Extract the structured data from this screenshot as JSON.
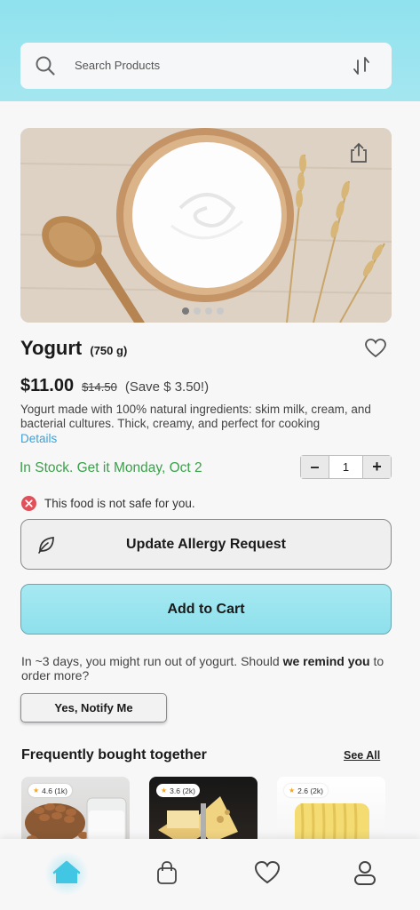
{
  "search": {
    "placeholder": "Search Products"
  },
  "product": {
    "name": "Yogurt",
    "weight": "(750 g)",
    "price": "$11.00",
    "old_price": "$14.50",
    "save": "(Save $ 3.50!)",
    "description": "Yogurt made with 100% natural ingredients: skim milk, cream, and bacterial cultures. Thick, creamy, and perfect for cooking",
    "details_link": "Details",
    "stock": "In Stock. Get it Monday, Oct 2",
    "quantity": "1",
    "image_count": 4,
    "active_image": 1
  },
  "qty": {
    "minus": "–",
    "plus": "+"
  },
  "warning": {
    "text": "This food is not safe for you."
  },
  "buttons": {
    "allergy": "Update Allergy Request",
    "add_to_cart": "Add to Cart",
    "notify": "Yes, Notify Me"
  },
  "reminder": {
    "prefix": "In ~3 days, you might run out of yogurt. Should ",
    "bold": "we remind you",
    "suffix": " to order more?"
  },
  "fbt": {
    "title": "Frequently bought together",
    "see_all": "See All",
    "items": [
      {
        "rating": "4.6 (1k)"
      },
      {
        "rating": "3.6 (2k)"
      },
      {
        "rating": "2.6 (2k)"
      }
    ]
  },
  "colors": {
    "header": "#8fe2ee",
    "accent": "#8ee0ec",
    "stock_green": "#3aa14a",
    "link_blue": "#3aa2d8",
    "warning_red": "#e0505a"
  },
  "icons": {
    "search": "search-icon",
    "sort": "sort-icon",
    "share": "share-icon",
    "favorite": "heart-icon",
    "warning": "x-circle-icon",
    "leaf": "leaf-icon",
    "tabs": [
      "home-icon",
      "bag-icon",
      "heart-icon",
      "user-icon"
    ]
  }
}
